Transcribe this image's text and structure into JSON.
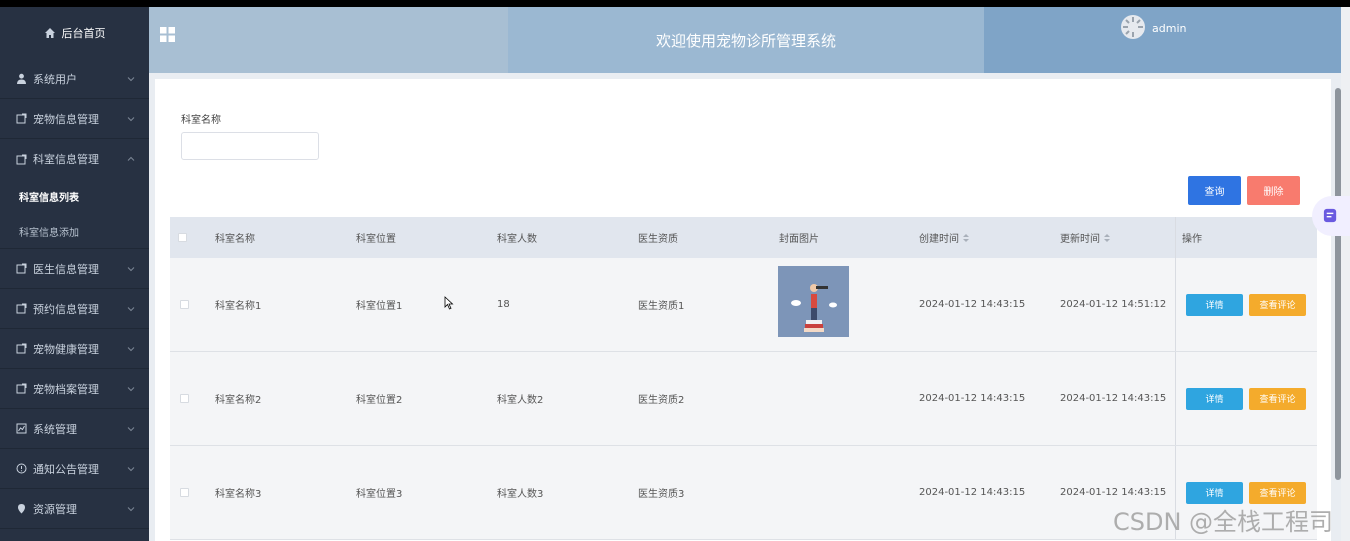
{
  "sidebar": {
    "home_label": "后台首页",
    "items": [
      {
        "label": "系统用户",
        "icon": "user-icon"
      },
      {
        "label": "宠物信息管理",
        "icon": "doc-icon"
      },
      {
        "label": "科室信息管理",
        "icon": "doc-icon",
        "expanded": true
      },
      {
        "label": "医生信息管理",
        "icon": "doc-icon"
      },
      {
        "label": "预约信息管理",
        "icon": "doc-icon"
      },
      {
        "label": "宠物健康管理",
        "icon": "doc-icon"
      },
      {
        "label": "宠物档案管理",
        "icon": "doc-icon"
      },
      {
        "label": "系统管理",
        "icon": "chart-icon"
      },
      {
        "label": "通知公告管理",
        "icon": "info-icon"
      },
      {
        "label": "资源管理",
        "icon": "pin-icon"
      }
    ],
    "subitems": [
      {
        "label": "科室信息列表",
        "active": true
      },
      {
        "label": "科室信息添加",
        "active": false
      }
    ]
  },
  "header": {
    "title": "欢迎使用宠物诊所管理系统",
    "username": "admin"
  },
  "search": {
    "label": "科室名称",
    "value": "",
    "query_button": "查询",
    "delete_button": "删除"
  },
  "table": {
    "columns": [
      "科室名称",
      "科室位置",
      "科室人数",
      "医生资质",
      "封面图片",
      "创建时间",
      "更新时间",
      "操作"
    ],
    "rows": [
      {
        "name": "科室名称1",
        "location": "科室位置1",
        "count": "18",
        "qualification": "医生资质1",
        "has_cover": true,
        "created": "2024-01-12 14:43:15",
        "updated": "2024-01-12 14:51:12"
      },
      {
        "name": "科室名称2",
        "location": "科室位置2",
        "count": "科室人数2",
        "qualification": "医生资质2",
        "has_cover": false,
        "created": "2024-01-12 14:43:15",
        "updated": "2024-01-12 14:43:15"
      },
      {
        "name": "科室名称3",
        "location": "科室位置3",
        "count": "科室人数3",
        "qualification": "医生资质3",
        "has_cover": false,
        "created": "2024-01-12 14:43:15",
        "updated": "2024-01-12 14:43:15"
      }
    ],
    "detail_button": "详情",
    "comment_button": "查看评论"
  },
  "watermark": "CSDN @全栈工程司",
  "colors": {
    "sidebar_bg": "#273142",
    "query_btn": "#2f74e2",
    "delete_btn": "#f87b6e",
    "detail_btn": "#2fa5e0",
    "comment_btn": "#f4ab2c"
  }
}
